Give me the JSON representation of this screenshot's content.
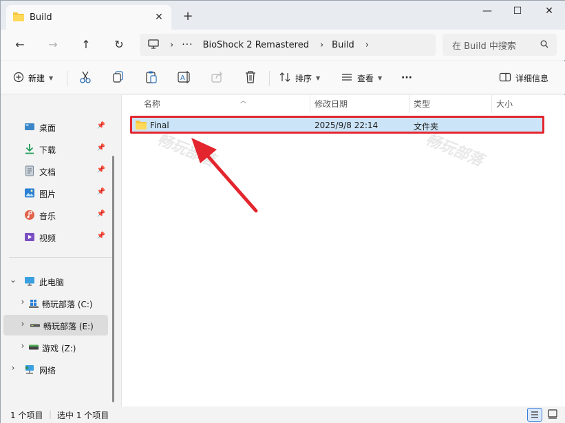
{
  "tab": {
    "title": "Build",
    "close": "✕",
    "new": "+"
  },
  "window_controls": {
    "minimize": "—",
    "maximize": "☐",
    "close": "✕"
  },
  "nav": {
    "back": "←",
    "forward": "→",
    "up": "↑",
    "refresh": "↻"
  },
  "address": {
    "separator": "›",
    "ellipsis": "···",
    "crumbs": [
      "BioShock 2 Remastered",
      "Build"
    ]
  },
  "search": {
    "placeholder": "在 Build 中搜索"
  },
  "commands": {
    "new_label": "新建",
    "sort_label": "排序",
    "view_label": "查看",
    "more": "···",
    "details_label": "详细信息"
  },
  "sidebar": {
    "quick_access": [
      {
        "label": "桌面",
        "icon": "desktop-icon",
        "color": "#3a86c8"
      },
      {
        "label": "下载",
        "icon": "download-icon",
        "color": "#1f9e5a"
      },
      {
        "label": "文档",
        "icon": "document-icon",
        "color": "#7a8794"
      },
      {
        "label": "图片",
        "icon": "picture-icon",
        "color": "#2b7fd4"
      },
      {
        "label": "音乐",
        "icon": "music-icon",
        "color": "#e0624a"
      },
      {
        "label": "视频",
        "icon": "video-icon",
        "color": "#7b4fc4"
      }
    ],
    "this_pc": "此电脑",
    "drives": [
      {
        "label": "畅玩部落 (C:)",
        "icon": "windows-drive-icon"
      },
      {
        "label": "畅玩部落 (E:)",
        "icon": "drive-icon"
      },
      {
        "label": "游戏 (Z:)",
        "icon": "drive-icon"
      }
    ],
    "network": "网络",
    "pin": "📌"
  },
  "columns": {
    "name": "名称",
    "modified": "修改日期",
    "type": "类型",
    "size": "大小"
  },
  "files": [
    {
      "name": "Final",
      "modified": "2025/9/8 22:14",
      "type": "文件夹",
      "size": ""
    }
  ],
  "watermark": "畅玩部落",
  "status": {
    "item_count": "1 个项目",
    "selected": "选中 1 个项目"
  },
  "colors": {
    "highlight": "#e3262e",
    "selection": "#cce4f7",
    "arrow": "#e3262e"
  }
}
